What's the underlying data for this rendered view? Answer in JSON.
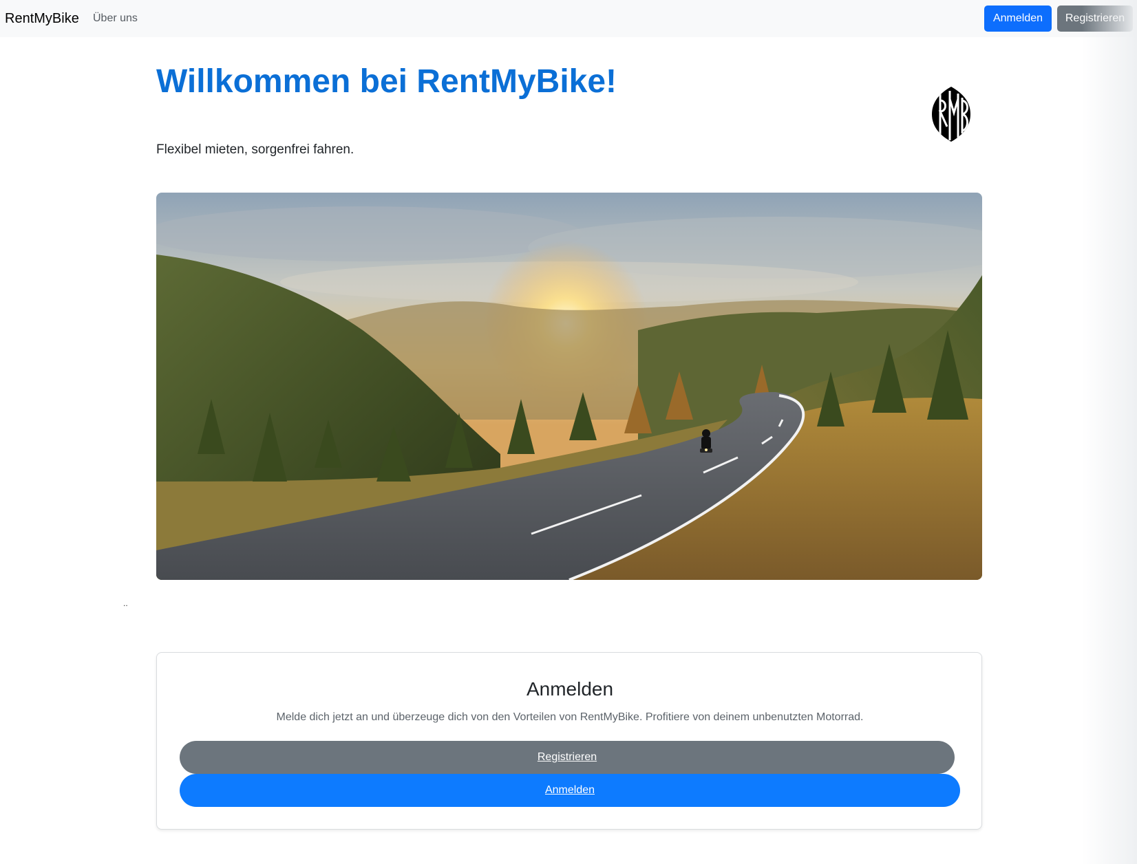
{
  "navbar": {
    "brand": "RentMyBike",
    "about_link": "Über uns",
    "login_button": "Anmelden",
    "register_button": "Registrieren"
  },
  "hero": {
    "title": "Willkommen bei RentMyBike!",
    "subtitle": "Flexibel mieten, sorgenfrei fahren.",
    "logo_letters": "RMB",
    "image_description": "motorcycle-road-sunset-mountains"
  },
  "stray_text": "..",
  "card": {
    "title": "Anmelden",
    "text": "Melde dich jetzt an und überzeuge dich von den Vorteilen von RentMyBike. Profitiere von deinem unbenutzten Motorrad.",
    "register_button": "Registrieren",
    "login_button": "Anmelden"
  },
  "colors": {
    "primary": "#0d6efd",
    "secondary": "#6c757d",
    "title_blue": "#0b6fd6",
    "navbar_bg": "#f8f9fa"
  }
}
